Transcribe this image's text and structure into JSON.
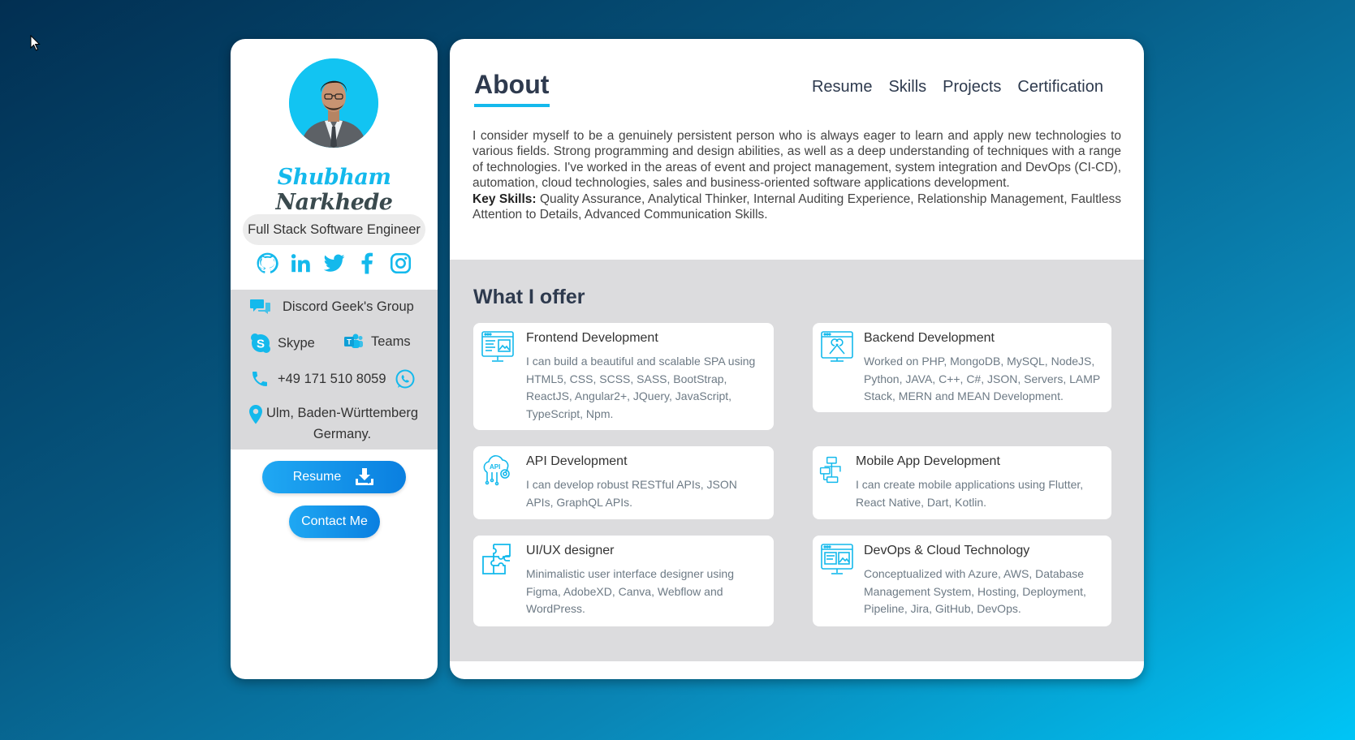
{
  "profile": {
    "first_name": "Shubham",
    "last_name": "Narkhede",
    "role": "Full Stack Software Engineer",
    "socials": [
      "github-icon",
      "linkedin-icon",
      "twitter-icon",
      "facebook-icon",
      "instagram-icon"
    ],
    "discord": "Discord Geek's Group",
    "skype": "Skype",
    "teams": "Teams",
    "phone": "+49 171 510 8059",
    "location_line1": "Ulm, Baden-Württemberg",
    "location_line2": "Germany.",
    "resume_button": "Resume",
    "contact_button": "Contact Me"
  },
  "main": {
    "title": "About",
    "nav": [
      "Resume",
      "Skills",
      "Projects",
      "Certification"
    ],
    "about_paragraph": "I consider myself to be a genuinely persistent person who is always eager to learn and apply new technologies to various fields. Strong programming and design abilities, as well as a deep understanding of techniques with a range of technologies. I've worked in the areas of event and project management, system integration and DevOps (CI-CD), automation, cloud technologies, sales and business-oriented software applications development.",
    "key_skills_label": "Key Skills:",
    "key_skills": "Quality Assurance, Analytical Thinker, Internal Auditing Experience, Relationship Management, Faultless Attention to Details, Advanced Communication Skills.",
    "offer_title": "What I offer",
    "offers": [
      {
        "title": "Frontend Development",
        "desc": "I can build a beautiful and scalable SPA using HTML5, CSS, SCSS, SASS, BootStrap, ReactJS, Angular2+, JQuery, JavaScript, TypeScript, Npm.",
        "icon": "frontend-icon"
      },
      {
        "title": "Backend Development",
        "desc": "Worked on PHP, MongoDB, MySQL, NodeJS, Python, JAVA, C++, C#, JSON, Servers, LAMP Stack, MERN and MEAN Development.",
        "icon": "backend-icon"
      },
      {
        "title": "API Development",
        "desc": "I can develop robust RESTful APIs, JSON APIs, GraphQL APIs.",
        "icon": "api-icon"
      },
      {
        "title": "Mobile App Development",
        "desc": "I can create mobile applications using Flutter, React Native, Dart, Kotlin.",
        "icon": "mobile-app-icon"
      },
      {
        "title": "UI/UX designer",
        "desc": "Minimalistic user interface designer using Figma, AdobeXD, Canva, Webflow and WordPress.",
        "icon": "puzzle-icon"
      },
      {
        "title": "DevOps & Cloud Technology",
        "desc": "Conceptualized with Azure, AWS, Database Management System, Hosting, Deployment, Pipeline, Jira, GitHub, DevOps.",
        "icon": "devops-icon"
      }
    ]
  },
  "colors": {
    "accent": "#14b9ec",
    "heading": "#2e3a4e",
    "contact_bg": "#d9d9db",
    "offer_bg": "#dcdcde"
  }
}
